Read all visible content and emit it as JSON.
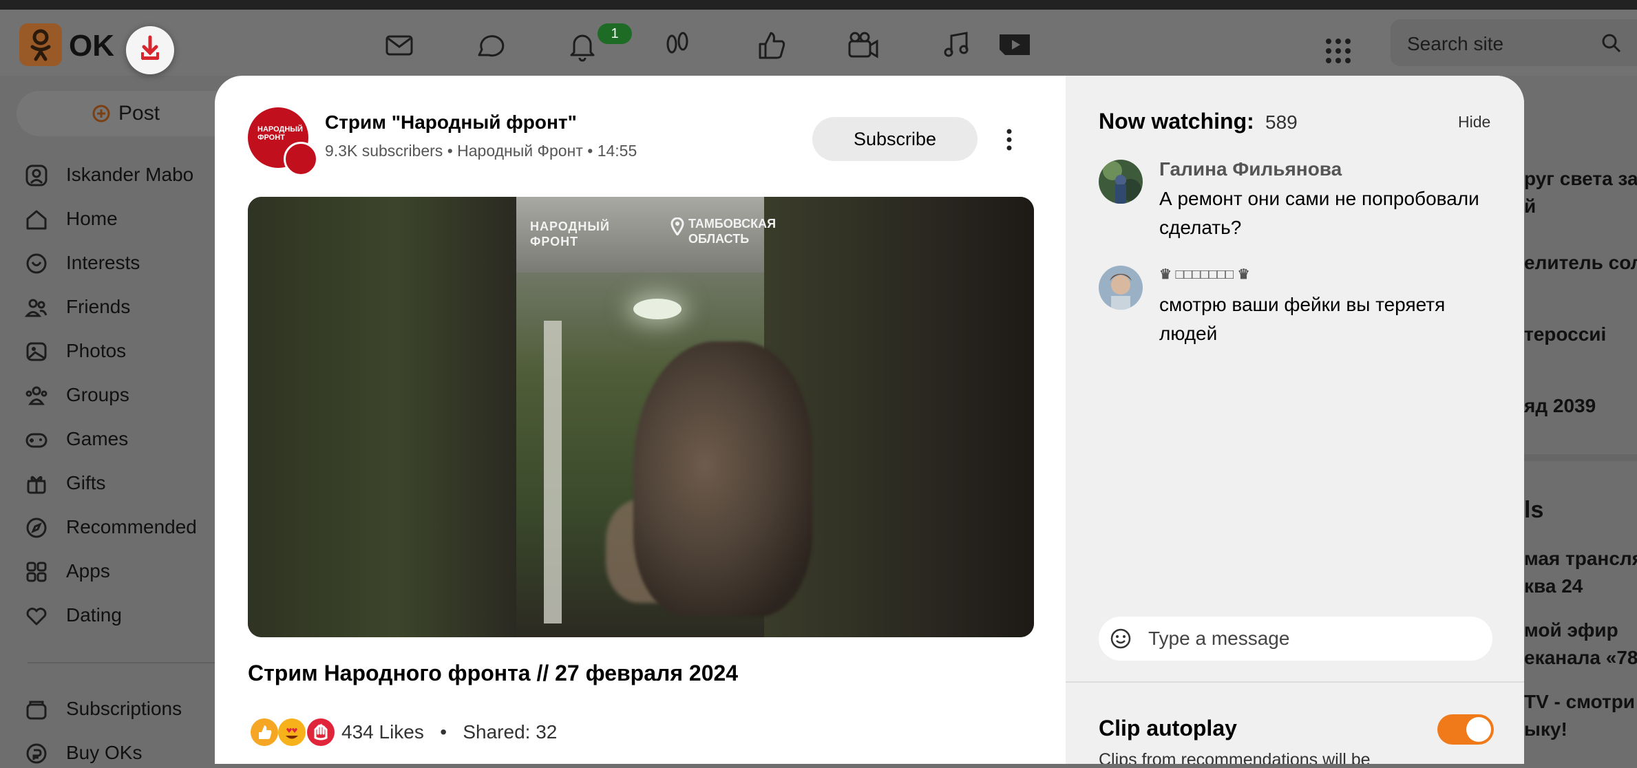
{
  "header": {
    "logo_text": "OK",
    "notification_badge": "1",
    "search_placeholder": "Search site",
    "nav_icons": [
      "mail-icon",
      "chat-icon",
      "bell-icon",
      "footprints-icon",
      "like-icon",
      "video-camera-icon",
      "music-icon",
      "play-icon"
    ]
  },
  "sidebar": {
    "post_label": "Post",
    "items": [
      {
        "label": "Iskander Mabo",
        "icon": "profile-icon"
      },
      {
        "label": "Home",
        "icon": "home-icon"
      },
      {
        "label": "Interests",
        "icon": "interests-icon"
      },
      {
        "label": "Friends",
        "icon": "friends-icon"
      },
      {
        "label": "Photos",
        "icon": "photos-icon"
      },
      {
        "label": "Groups",
        "icon": "groups-icon"
      },
      {
        "label": "Games",
        "icon": "gamepad-icon"
      },
      {
        "label": "Gifts",
        "icon": "gift-icon"
      },
      {
        "label": "Recommended",
        "icon": "compass-icon"
      },
      {
        "label": "Apps",
        "icon": "apps-icon"
      },
      {
        "label": "Dating",
        "icon": "hearts-icon"
      },
      {
        "label": "Subscriptions",
        "icon": "subscriptions-icon"
      },
      {
        "label": "Buy OKs",
        "icon": "coin-icon"
      }
    ]
  },
  "background_feed": {
    "items": [
      "руг света за",
      "й",
      "елитель сол",
      "тероссиi",
      "яд 2039",
      "ls",
      "мая трансля",
      "ква 24",
      "мой эфир",
      "еканала «78.",
      "TV - смотри",
      "ыку!"
    ]
  },
  "post": {
    "channel_name": "Стрим \"Народный фронт\"",
    "subscribers": "9.3K subscribers",
    "channel_group": "Народный Фронт",
    "time": "14:55",
    "subscribe_label": "Subscribe",
    "avatar_text": "НАРОДНЫЙ ФРОНТ",
    "video_brand": "НАРОДНЫЙ\nФРОНТ",
    "video_region": "ТАМБОВСКАЯ\nОБЛАСТЬ",
    "video_title": "Стрим Народного фронта // 27 февраля 2024",
    "likes": "434 Likes",
    "shared": "Shared: 32"
  },
  "live_chat": {
    "title": "Now watching:",
    "count": "589",
    "hide_label": "Hide",
    "comments": [
      {
        "author": "Галина Фильянова",
        "text": "А ремонт они сами не попробовали сделать?"
      },
      {
        "author": "♛ □□□□□□□ ♛",
        "text": "смотрю ваши фейки вы теряетя людей"
      }
    ],
    "message_placeholder": "Type a message"
  },
  "autoplay": {
    "title": "Clip autoplay",
    "description": "Clips from recommendations will be",
    "enabled": true
  },
  "colors": {
    "accent_orange": "#f07a1a",
    "channel_red": "#c20f1e",
    "badge_green": "#1d6b25"
  }
}
